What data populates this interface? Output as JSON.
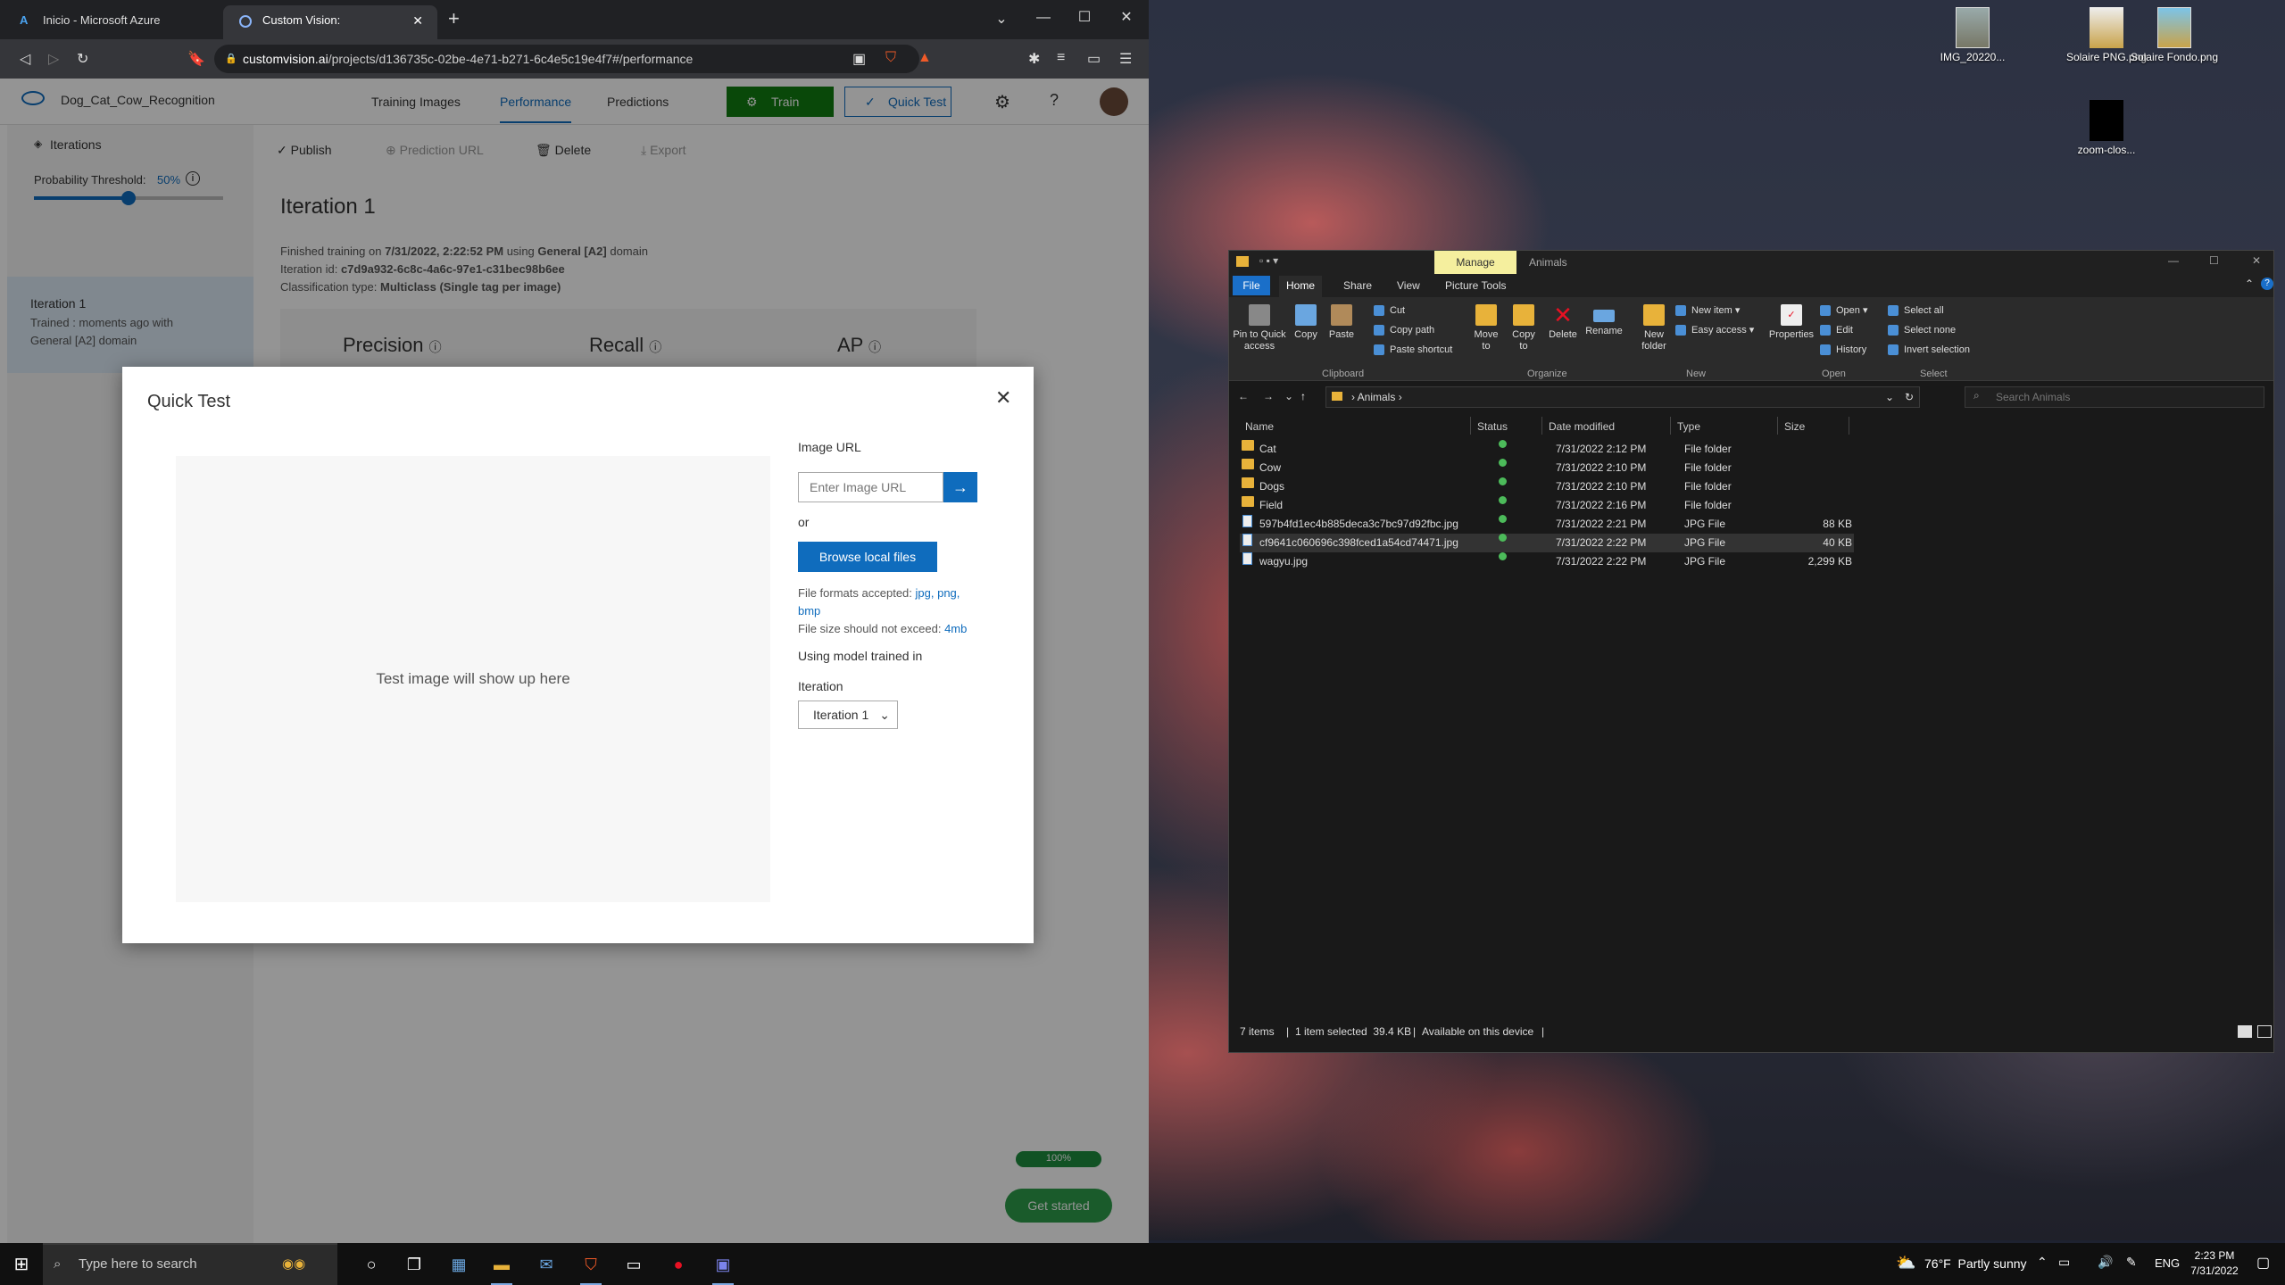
{
  "desktop": {
    "icons": [
      {
        "label": "IMG_20220...",
        "x_label": "img"
      },
      {
        "label": "Solaire PNG.png"
      },
      {
        "label": "Solaire Fondo.png"
      },
      {
        "label": "zoom-clos..."
      }
    ]
  },
  "browser": {
    "tabs": [
      {
        "title": "Inicio - Microsoft Azure"
      },
      {
        "title": "Custom Vision: Dog_Cat_Cow_Re"
      }
    ],
    "new_tab": "+",
    "url_host": "customvision.ai",
    "url_path": "/projects/d136735c-02be-4e71-b271-6c4e5c19e4f7#/performance"
  },
  "app": {
    "project_name": "Dog_Cat_Cow_Recognition",
    "nav": {
      "training_images": "Training Images",
      "performance": "Performance",
      "predictions": "Predictions"
    },
    "train_button": "Train",
    "quick_test_button": "Quick Test",
    "sidebar": {
      "iterations_label": "Iterations",
      "threshold_label": "Probability Threshold:",
      "threshold_value": "50%",
      "threshold_fraction": 0.5,
      "iteration_title": "Iteration 1",
      "iteration_desc_1": "Trained : moments ago with",
      "iteration_desc_2": "General [A2] domain"
    },
    "toolbar": {
      "publish": "Publish",
      "prediction_url": "Prediction URL",
      "delete": "Delete",
      "export": "Export"
    },
    "iteration_heading": "Iteration 1",
    "finished_prefix": "Finished training on",
    "finished_date": "7/31/2022, 2:22:52 PM",
    "finished_using": "using",
    "finished_domain": "General [A2]",
    "finished_suffix": "domain",
    "iteration_id_label": "Iteration id:",
    "iteration_id": "c7d9a932-6c8c-4a6c-97e1-c31bec98b6ee",
    "classification_label": "Classification type:",
    "classification_value": "Multiclass (Single tag per image)",
    "metrics": {
      "precision": "Precision",
      "recall": "Recall",
      "ap": "AP"
    },
    "progress_label": "100%",
    "progress_fraction": 1.0,
    "get_started": "Get started"
  },
  "quick_test": {
    "title": "Quick Test",
    "placeholder_text": "Test image will show up here",
    "image_url_label": "Image URL",
    "image_url_placeholder": "Enter Image URL",
    "or": "or",
    "browse_button": "Browse local files",
    "formats_prefix": "File formats accepted:",
    "formats_link_1": "jpg, png,",
    "formats_link_2": "bmp",
    "size_prefix": "File size should not exceed:",
    "size_link": "4mb",
    "using_model": "Using model trained in",
    "iteration_label": "Iteration",
    "iteration_select": "Iteration 1"
  },
  "explorer": {
    "manage_tab": "Manage",
    "title": "Animals",
    "ribbon_tabs": [
      "File",
      "Home",
      "Share",
      "View",
      "Picture Tools"
    ],
    "clipboard": {
      "pin": "Pin to Quick access",
      "copy": "Copy",
      "paste": "Paste",
      "cut": "Cut",
      "copy_path": "Copy path",
      "paste_shortcut": "Paste shortcut",
      "group": "Clipboard"
    },
    "organize": {
      "move": "Move to",
      "copy": "Copy to",
      "delete": "Delete",
      "rename": "Rename",
      "group": "Organize"
    },
    "new": {
      "new_folder": "New folder",
      "new_item": "New item",
      "easy_access": "Easy access",
      "group": "New"
    },
    "open": {
      "properties": "Properties",
      "open": "Open",
      "edit": "Edit",
      "history": "History",
      "group": "Open"
    },
    "select": {
      "all": "Select all",
      "none": "Select none",
      "invert": "Invert selection",
      "group": "Select"
    },
    "path": "Animals",
    "search_placeholder": "Search Animals",
    "columns": {
      "name": "Name",
      "status": "Status",
      "modified": "Date modified",
      "type": "Type",
      "size": "Size"
    },
    "files": [
      {
        "name": "Cat",
        "modified": "7/31/2022 2:12 PM",
        "type": "File folder",
        "size": "",
        "kind": "folder"
      },
      {
        "name": "Cow",
        "modified": "7/31/2022 2:10 PM",
        "type": "File folder",
        "size": "",
        "kind": "folder"
      },
      {
        "name": "Dogs",
        "modified": "7/31/2022 2:10 PM",
        "type": "File folder",
        "size": "",
        "kind": "folder"
      },
      {
        "name": "Field",
        "modified": "7/31/2022 2:16 PM",
        "type": "File folder",
        "size": "",
        "kind": "folder"
      },
      {
        "name": "597b4fd1ec4b885deca3c7bc97d92fbc.jpg",
        "modified": "7/31/2022 2:21 PM",
        "type": "JPG File",
        "size": "88 KB",
        "kind": "jpg"
      },
      {
        "name": "cf9641c060696c398fced1a54cd74471.jpg",
        "modified": "7/31/2022 2:22 PM",
        "type": "JPG File",
        "size": "40 KB",
        "kind": "jpg",
        "selected": true
      },
      {
        "name": "wagyu.jpg",
        "modified": "7/31/2022 2:22 PM",
        "type": "JPG File",
        "size": "2,299 KB",
        "kind": "jpg"
      }
    ],
    "status": {
      "items": "7 items",
      "selected": "1 item selected  39.4 KB",
      "available": "Available on this device"
    }
  },
  "taskbar": {
    "search_placeholder": "Type here to search",
    "weather": "76°F  Partly sunny",
    "lang": "ENG",
    "time": "2:23 PM",
    "date": "7/31/2022"
  }
}
